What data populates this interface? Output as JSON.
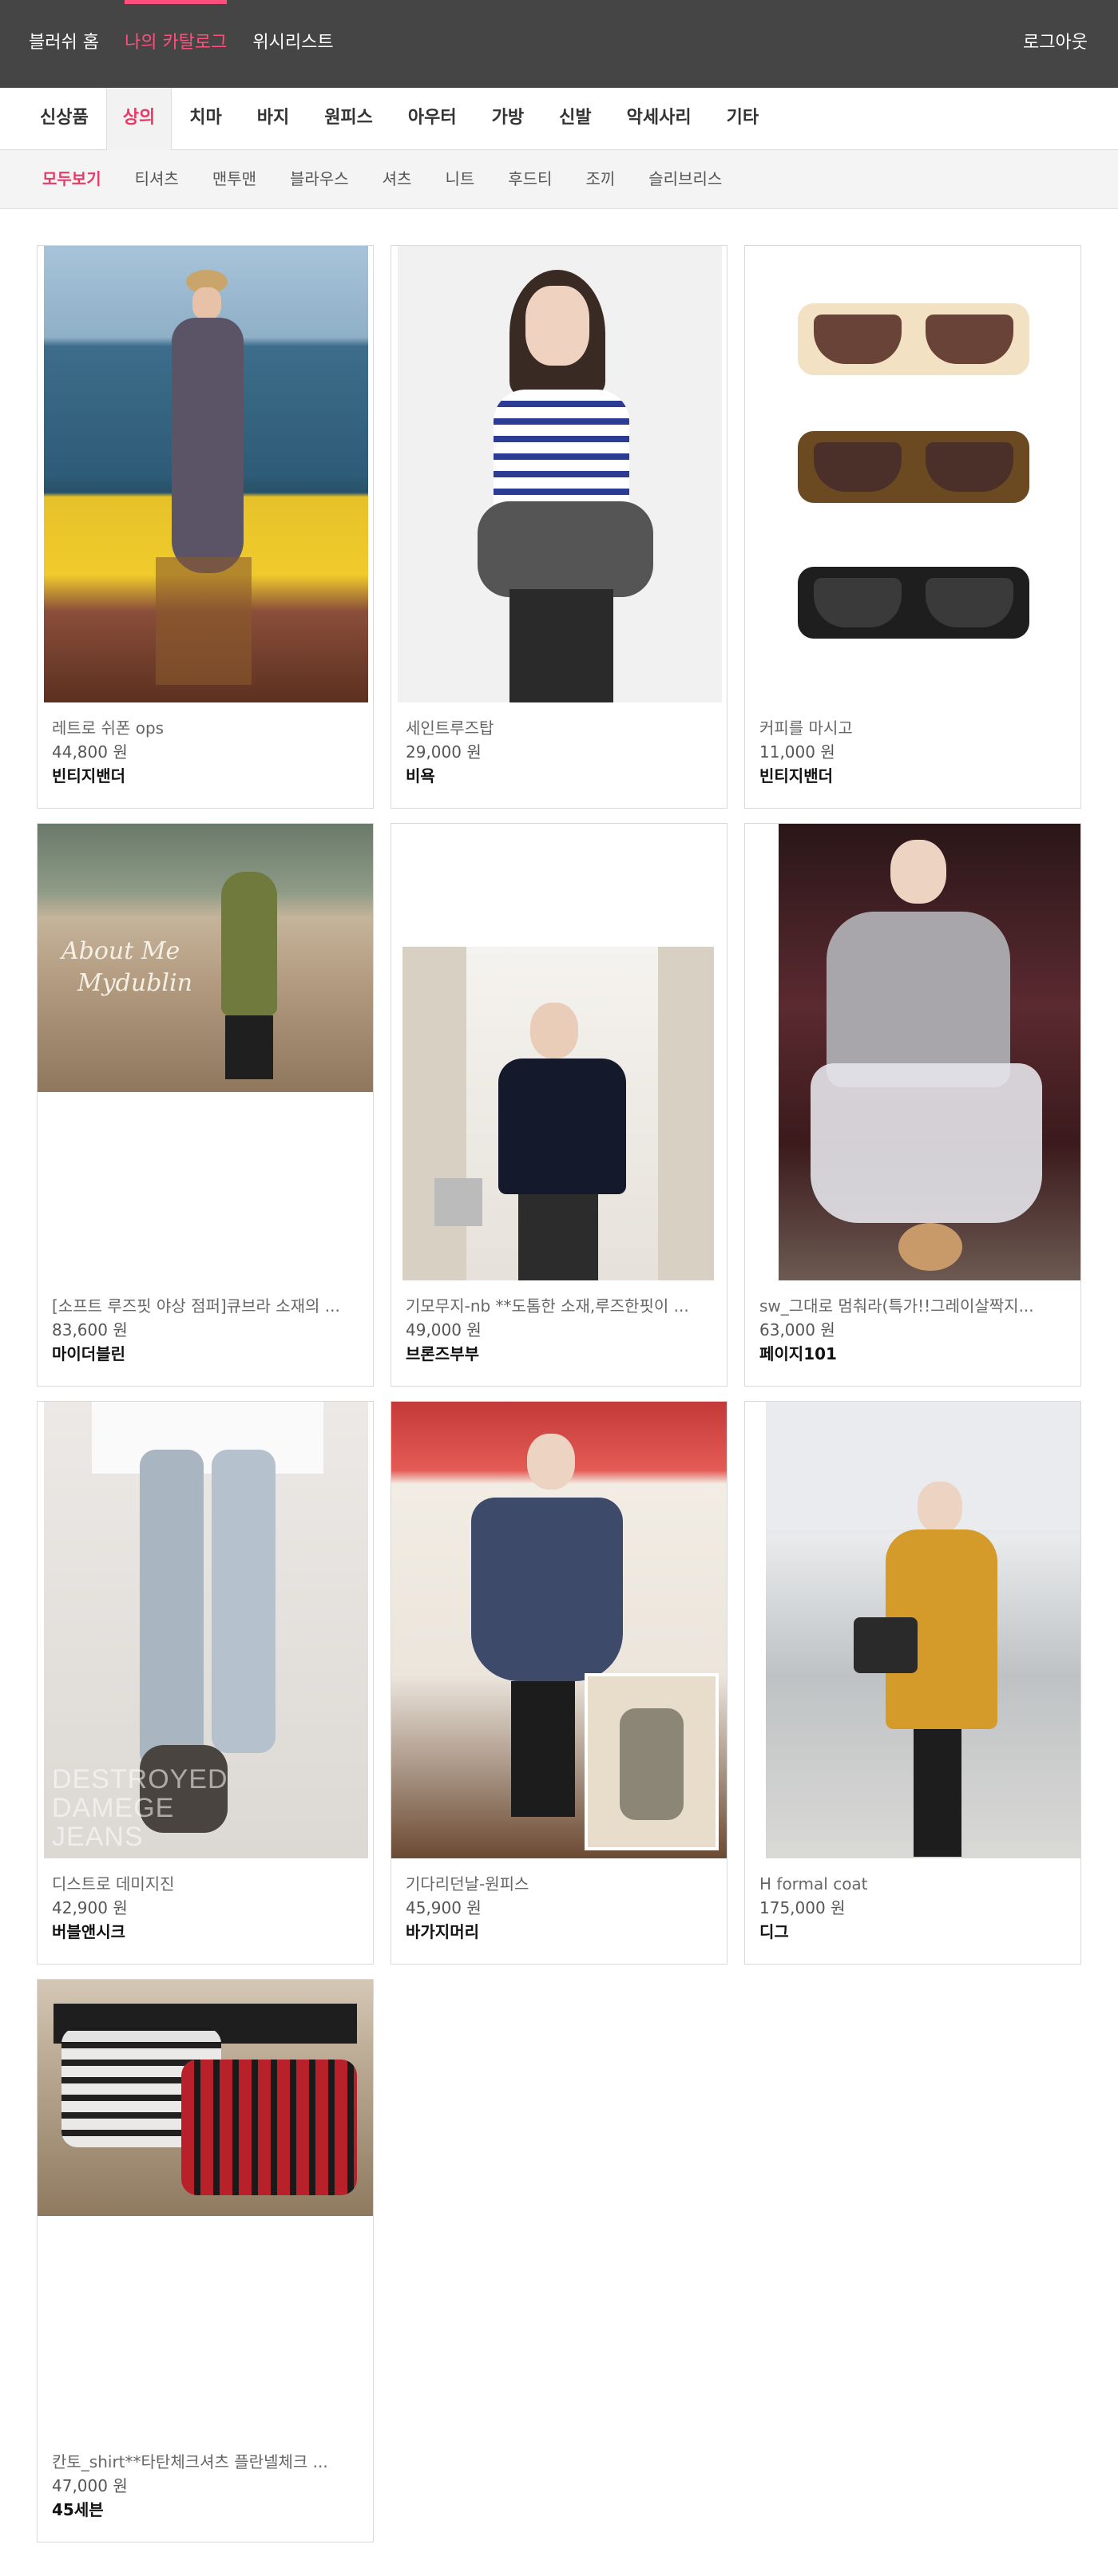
{
  "topbar": {
    "nav": [
      "블러쉬 홈",
      "나의 카탈로그",
      "위시리스트"
    ],
    "active_index": 1,
    "logout": "로그아웃",
    "accent": "#ff4f7d"
  },
  "categories": {
    "items": [
      "신상품",
      "상의",
      "치마",
      "바지",
      "원피스",
      "아우터",
      "가방",
      "신발",
      "악세사리",
      "기타"
    ],
    "active_index": 1
  },
  "subcategories": {
    "items": [
      "모두보기",
      "티셔츠",
      "맨투맨",
      "블라우스",
      "셔츠",
      "니트",
      "후드티",
      "조끼",
      "슬리브리스"
    ],
    "active_index": 0
  },
  "products": [
    {
      "name": "레트로 쉬폰 ops",
      "price": "44,800 원",
      "shop": "빈티지밴더",
      "image": "woman-seaside-dress-photo"
    },
    {
      "name": "세인트루즈탑",
      "price": "29,000 원",
      "shop": "비욕",
      "image": "striped-top-photo"
    },
    {
      "name": "커피를 마시고",
      "price": "11,000 원",
      "shop": "빈티지밴더",
      "image": "sunglasses-photo"
    },
    {
      "name": "[소프트 루즈핏 야상 점퍼]큐브라 소재의 ...",
      "price": "83,600 원",
      "shop": "마이더블린",
      "image": "khaki-jacket-beach-photo"
    },
    {
      "name": "기모무지-nb **도톰한 소재,루즈한핏이 ...",
      "price": "49,000 원",
      "shop": "브론즈부부",
      "image": "navy-blouse-photo"
    },
    {
      "name": "sw_그대로 멈춰라(특가!!그레이살짝지...",
      "price": "63,000 원",
      "shop": "페이지101",
      "image": "grey-knit-photo"
    },
    {
      "name": "디스트로 데미지진",
      "price": "42,900 원",
      "shop": "버블앤시크",
      "image": "damaged-jeans-photo"
    },
    {
      "name": "기다리던날-원피스",
      "price": "45,900 원",
      "shop": "바가지머리",
      "image": "floral-dress-photo"
    },
    {
      "name": "H formal coat",
      "price": "175,000 원",
      "shop": "디그",
      "image": "mustard-coat-photo"
    },
    {
      "name": "칸토_shirt**타탄체크셔츠 플란넬체크 ...",
      "price": "47,000 원",
      "shop": "45세븐",
      "image": "check-shirts-photo"
    }
  ],
  "jeans_watermark": [
    "DESTROYED",
    "DAMEGE",
    "JEANS"
  ],
  "beach_watermark": [
    "About Me",
    "Mydublin"
  ]
}
